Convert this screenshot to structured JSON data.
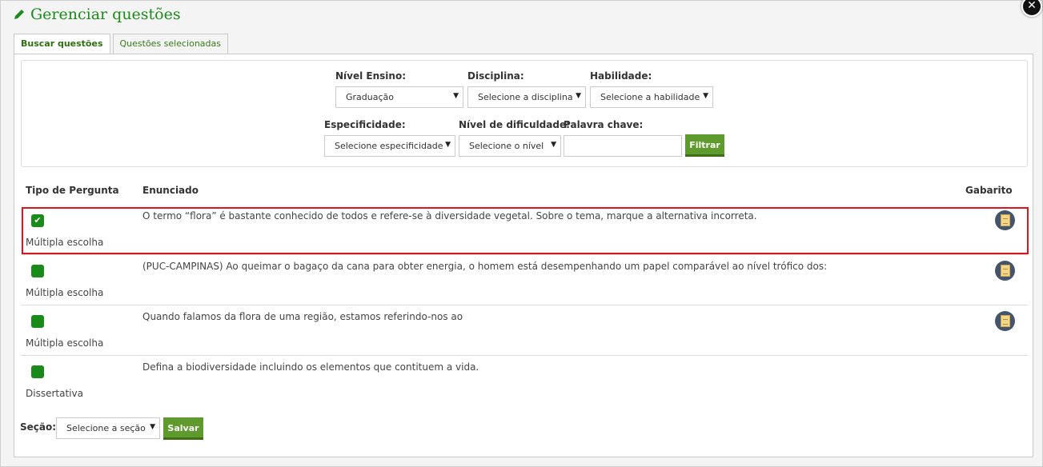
{
  "title": "Gerenciar questões",
  "close_label": "✕",
  "tabs": [
    "Buscar questões",
    "Questões selecionadas"
  ],
  "filters": {
    "nivel_ensino": {
      "label": "Nível Ensino:",
      "value": "Graduação"
    },
    "disciplina": {
      "label": "Disciplina:",
      "value": "Selecione a disciplina"
    },
    "habilidade": {
      "label": "Habilidade:",
      "value": "Selecione a habilidade"
    },
    "especificidade": {
      "label": "Especificidade:",
      "value": "Selecione especificidade"
    },
    "dificuldade": {
      "label": "Nível de dificuldade:",
      "value": "Selecione o nível"
    },
    "palavra_chave": {
      "label": "Palavra chave:",
      "value": ""
    },
    "filtrar_label": "Filtrar"
  },
  "table": {
    "headers": [
      "Tipo de Pergunta",
      "Enunciado",
      "Gabarito"
    ],
    "rows": [
      {
        "tipo": "Múltipla escolha",
        "enunciado": "O termo “flora” é bastante conhecido de todos e refere-se à diversidade vegetal. Sobre o tema, marque a alternativa incorreta.",
        "checked": true,
        "gabarito": true
      },
      {
        "tipo": "Múltipla escolha",
        "enunciado": "(PUC-CAMPINAS) Ao queimar o bagaço da cana para obter energia, o homem está desempenhando um papel comparável ao nível trófico dos:",
        "checked": false,
        "gabarito": true
      },
      {
        "tipo": "Múltipla escolha",
        "enunciado": "Quando falamos da flora de uma região, estamos referindo-nos ao",
        "checked": false,
        "gabarito": true
      },
      {
        "tipo": "Dissertativa",
        "enunciado": "Defina a biodiversidade incluindo os elementos que contituem a vida.",
        "checked": false,
        "gabarito": false
      }
    ]
  },
  "footer": {
    "secao_label": "Seção:",
    "secao_value": "Selecione a seção",
    "salvar_label": "Salvar"
  },
  "colors": {
    "accent": "#1d8a1d",
    "button": "#5f9a2c",
    "highlight": "#e0141e"
  }
}
